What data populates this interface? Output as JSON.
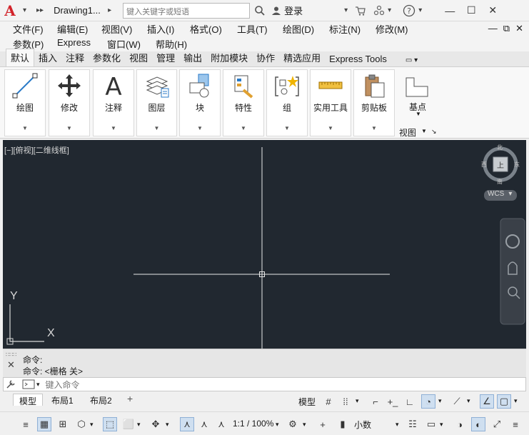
{
  "titlebar": {
    "doc_title": "Drawing1...",
    "search_placeholder": "键入关键字或短语",
    "login_label": "登录",
    "minimize": "—",
    "maximize": "☐",
    "close": "✕"
  },
  "menu": {
    "row1": [
      "文件(F)",
      "编辑(E)",
      "视图(V)",
      "插入(I)",
      "格式(O)",
      "工具(T)",
      "绘图(D)",
      "标注(N)",
      "修改(M)"
    ],
    "row2": [
      "参数(P)",
      "Express",
      "窗口(W)",
      "帮助(H)"
    ]
  },
  "ribbon_tabs": [
    "默认",
    "插入",
    "注释",
    "参数化",
    "视图",
    "管理",
    "输出",
    "附加模块",
    "协作",
    "精选应用",
    "Express Tools"
  ],
  "ribbon_panels": [
    "绘图",
    "修改",
    "注释",
    "图层",
    "块",
    "特性",
    "组",
    "实用工具",
    "剪贴板",
    "基点"
  ],
  "view_panel_label": "视图",
  "viewport": {
    "label": "[−][俯视][二维线框]",
    "compass": {
      "n": "北",
      "s": "南",
      "e": "东",
      "w": "西",
      "top": "上"
    },
    "wcs": "WCS",
    "ucs_y": "Y",
    "ucs_x": "X"
  },
  "command": {
    "line1": "命令:",
    "line2": "命令: <栅格 关>",
    "placeholder": "键入命令"
  },
  "layout_tabs": [
    "模型",
    "布局1",
    "布局2"
  ],
  "status": {
    "model": "模型",
    "scale": "1:1 / 100%",
    "units": "小数"
  }
}
